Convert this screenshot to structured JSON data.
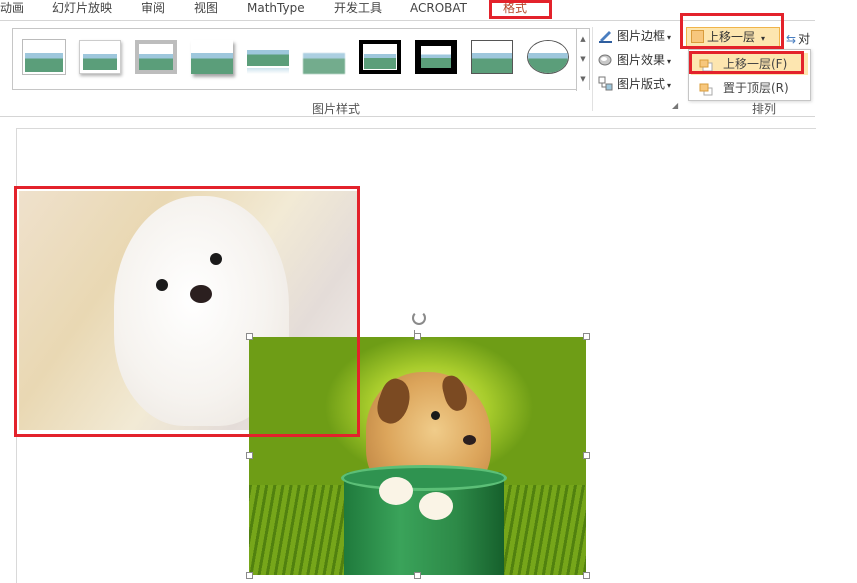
{
  "tabs": [
    {
      "label": "动画"
    },
    {
      "label": "幻灯片放映"
    },
    {
      "label": "审阅"
    },
    {
      "label": "视图"
    },
    {
      "label": "MathType"
    },
    {
      "label": "开发工具"
    },
    {
      "label": "ACROBAT"
    },
    {
      "label": "格式",
      "active": true
    }
  ],
  "ribbon": {
    "picture_styles_group": "图片样式",
    "arrange_group": "排列",
    "border_label": "图片边框",
    "effects_label": "图片效果",
    "layout_label": "图片版式",
    "bring_forward_label": "上移一层",
    "align_label": "对"
  },
  "bring_forward_menu": {
    "items": [
      {
        "label": "上移一层(F)",
        "highlighted": true
      },
      {
        "label": "置于顶层(R)",
        "highlighted": false
      }
    ]
  },
  "colors": {
    "highlight_box": "#e3222b",
    "active_tab": "#b7472a",
    "hover_fill": "#fde6b0"
  }
}
